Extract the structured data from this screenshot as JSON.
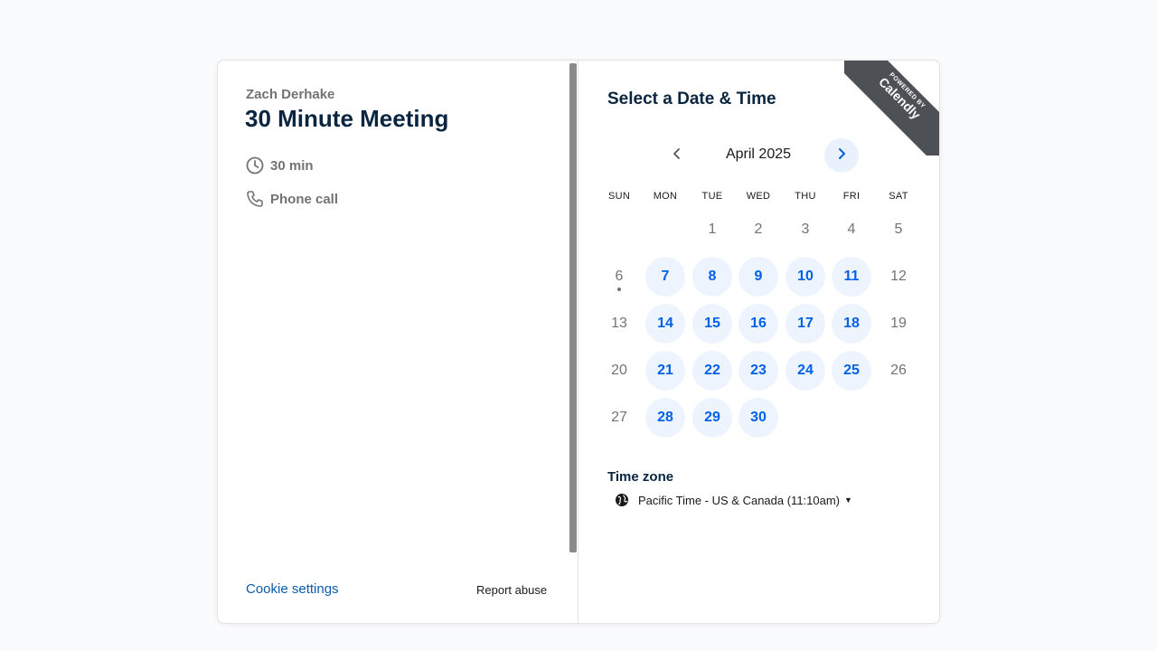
{
  "event": {
    "organizer": "Zach Derhake",
    "title": "30 Minute Meeting",
    "duration": "30 min",
    "location": "Phone call"
  },
  "footer": {
    "cookie_settings": "Cookie settings",
    "report_abuse": "Report abuse"
  },
  "calendar": {
    "heading": "Select a Date & Time",
    "month_label": "April 2025",
    "weekdays": [
      "SUN",
      "MON",
      "TUE",
      "WED",
      "THU",
      "FRI",
      "SAT"
    ],
    "days": [
      {
        "d": "1",
        "avail": false
      },
      {
        "d": "2",
        "avail": false
      },
      {
        "d": "3",
        "avail": false
      },
      {
        "d": "4",
        "avail": false
      },
      {
        "d": "5",
        "avail": false
      },
      {
        "d": "6",
        "avail": false,
        "today": true
      },
      {
        "d": "7",
        "avail": true
      },
      {
        "d": "8",
        "avail": true
      },
      {
        "d": "9",
        "avail": true
      },
      {
        "d": "10",
        "avail": true
      },
      {
        "d": "11",
        "avail": true
      },
      {
        "d": "12",
        "avail": false
      },
      {
        "d": "13",
        "avail": false
      },
      {
        "d": "14",
        "avail": true
      },
      {
        "d": "15",
        "avail": true
      },
      {
        "d": "16",
        "avail": true
      },
      {
        "d": "17",
        "avail": true
      },
      {
        "d": "18",
        "avail": true
      },
      {
        "d": "19",
        "avail": false
      },
      {
        "d": "20",
        "avail": false
      },
      {
        "d": "21",
        "avail": true
      },
      {
        "d": "22",
        "avail": true
      },
      {
        "d": "23",
        "avail": true
      },
      {
        "d": "24",
        "avail": true
      },
      {
        "d": "25",
        "avail": true
      },
      {
        "d": "26",
        "avail": false
      },
      {
        "d": "27",
        "avail": false
      },
      {
        "d": "28",
        "avail": true
      },
      {
        "d": "29",
        "avail": true
      },
      {
        "d": "30",
        "avail": true
      }
    ],
    "first_weekday_index": 2
  },
  "timezone": {
    "label": "Time zone",
    "value": "Pacific Time - US & Canada (11:10am)"
  },
  "badge": {
    "powered_by": "POWERED BY",
    "brand": "Calendly"
  },
  "icons": {
    "clock": "clock-icon",
    "phone": "phone-icon",
    "prev": "chevron-left-icon",
    "next": "chevron-right-icon",
    "globe": "globe-icon",
    "caret": "caret-down-icon"
  },
  "colors": {
    "accent": "#0060e6",
    "available_bg": "#eef4fe",
    "title": "#0a2540",
    "muted": "#737373",
    "link": "#0b5cad",
    "ribbon": "#4d5055"
  }
}
